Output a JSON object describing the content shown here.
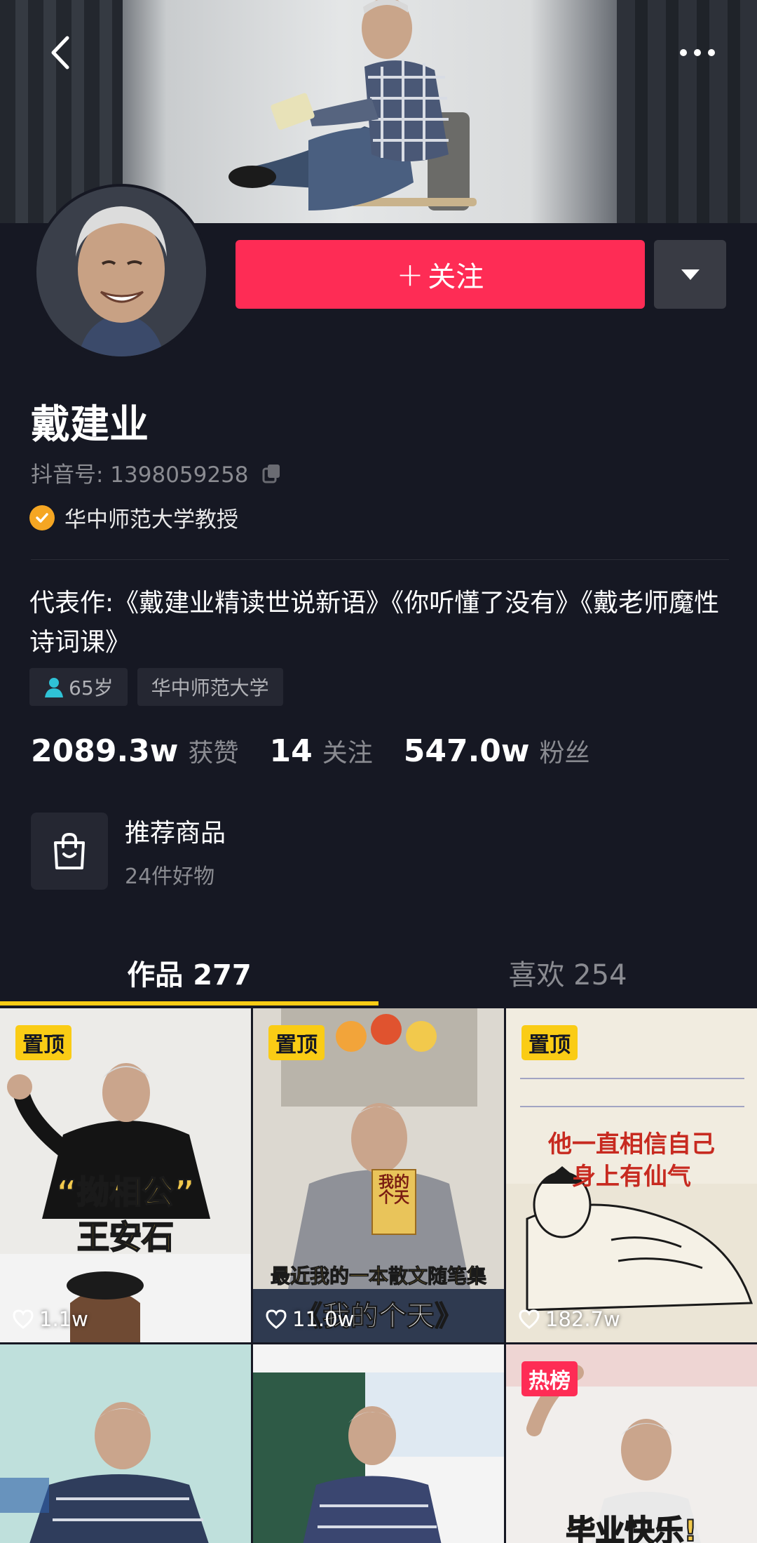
{
  "profile": {
    "name": "戴建业",
    "douyin_id": "抖音号: 1398059258",
    "verification": "华中师范大学教授",
    "bio": "代表作:《戴建业精读世说新语》《你听懂了没有》《戴老师魔性诗词课》",
    "tags": [
      {
        "label": "65岁",
        "icon": "person-icon"
      },
      {
        "label": "华中师范大学"
      }
    ]
  },
  "actions": {
    "follow_label": "关注",
    "follow_icon": "plus-icon",
    "more_icon": "triangle-down-icon"
  },
  "stats": [
    {
      "value": "2089.3w",
      "label": "获赞"
    },
    {
      "value": "14",
      "label": "关注"
    },
    {
      "value": "547.0w",
      "label": "粉丝"
    }
  ],
  "shop": {
    "title": "推荐商品",
    "subtitle": "24件好物",
    "icon": "shopping-bag-icon"
  },
  "tabs": [
    {
      "label": "作品 277",
      "active": true
    },
    {
      "label": "喜欢 254",
      "active": false
    }
  ],
  "videos": [
    {
      "badge": "置顶",
      "likes": "1.1w",
      "caption_top": "“拗相公”",
      "caption_bottom": "王安石"
    },
    {
      "badge": "置顶",
      "likes": "11.0w",
      "caption_top": "最近我的一本散文随笔集",
      "caption_bottom": "《我的个天》",
      "book_text": "我的个天"
    },
    {
      "badge": "置顶",
      "likes": "182.7w",
      "caption_top": "他一直相信自己",
      "caption_bottom": "身上有仙气"
    },
    {
      "badge": "",
      "likes": "",
      "caption_top": "",
      "caption_bottom": ""
    },
    {
      "badge": "",
      "likes": "",
      "caption_top": "",
      "caption_bottom": ""
    },
    {
      "badge": "热榜",
      "likes": "",
      "caption_top": "毕业快乐!",
      "caption_bottom": ""
    }
  ],
  "colors": {
    "background": "#161823",
    "follow_button": "#fe2c55",
    "tab_underline": "#facc15",
    "pin_badge": "#facc15",
    "hot_badge": "#fe2c55",
    "verify_badge": "#f5a623"
  }
}
